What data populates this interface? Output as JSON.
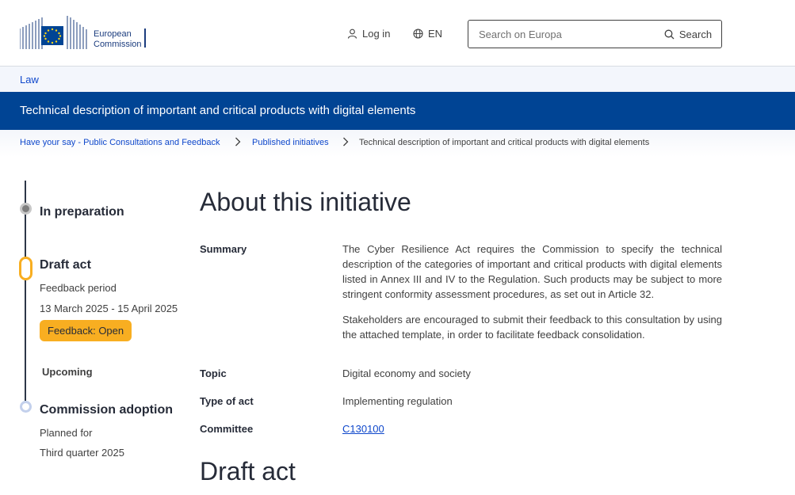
{
  "header": {
    "logo_alt": "European Commission",
    "logo_line1": "European",
    "logo_line2": "Commission",
    "login_label": "Log in",
    "language_label": "EN",
    "search_placeholder": "Search on Europa",
    "search_button_label": "Search"
  },
  "site_bar": {
    "link_label": "Law"
  },
  "page": {
    "title": "Technical description of important and critical products with digital elements"
  },
  "breadcrumb": {
    "items": [
      "Have your say - Public Consultations and Feedback",
      "Published initiatives",
      "Technical description of important and critical products with digital elements"
    ]
  },
  "timeline": {
    "step1": {
      "title": "In preparation"
    },
    "step2": {
      "title": "Draft act",
      "period_label": "Feedback period",
      "period_value": "13 March 2025 - 15 April 2025",
      "badge": "Feedback: Open"
    },
    "upcoming_label": "Upcoming",
    "step3": {
      "title": "Commission adoption",
      "planned_label": "Planned for",
      "planned_value": "Third quarter 2025"
    }
  },
  "content": {
    "heading": "About this initiative",
    "summary_label": "Summary",
    "summary_p1": "The Cyber Resilience Act requires the Commission to specify the technical description of the categories of important and critical products with digital elements listed in Annex III and IV to the Regulation. Such products may be subject to more stringent conformity assessment procedures, as set out in Article 32.",
    "summary_p2": "Stakeholders are encouraged to submit their feedback to this consultation by using the attached template, in order to facilitate feedback consolidation.",
    "topic_label": "Topic",
    "topic_value": "Digital economy and society",
    "type_label": "Type of act",
    "type_value": "Implementing regulation",
    "committee_label": "Committee",
    "committee_value": "C130100",
    "draft_heading": "Draft act"
  },
  "colors": {
    "title_bar": "#004494",
    "link": "#0e47cb",
    "accent_yellow": "#f8ae21"
  }
}
